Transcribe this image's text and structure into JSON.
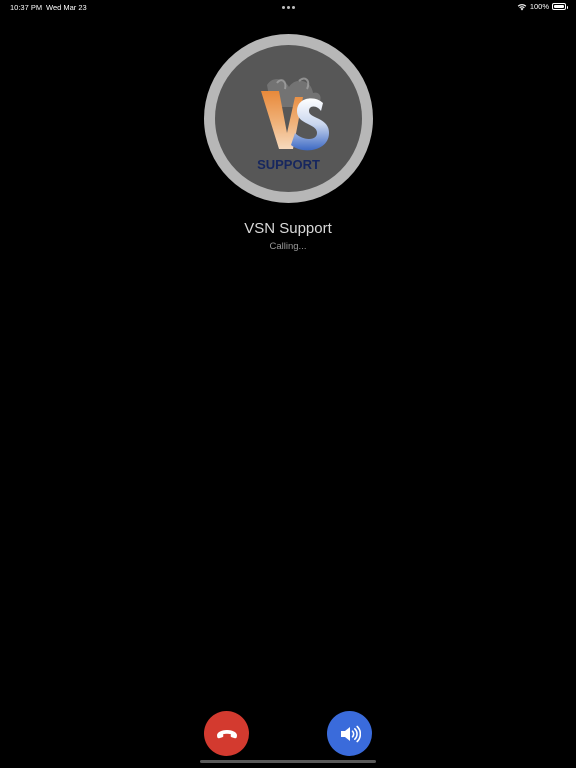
{
  "status_bar": {
    "time": "10:37 PM",
    "date": "Wed Mar 23",
    "battery_percent": "100%",
    "icons": [
      "wifi-icon",
      "battery-icon"
    ]
  },
  "caller": {
    "name": "VSN Support",
    "status": "Calling...",
    "avatar_logo_text": "VS SUPPORT"
  },
  "actions": {
    "end_call_icon": "phone-hangup-icon",
    "speaker_icon": "speaker-icon"
  },
  "colors": {
    "end_call": "#d33a2f",
    "speaker": "#3a6bdb",
    "avatar_ring": "#b7b7b7"
  }
}
